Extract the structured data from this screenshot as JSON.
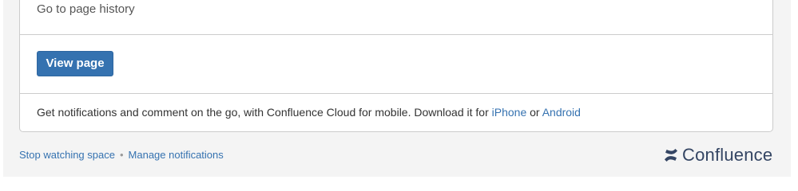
{
  "card": {
    "history_link": "Go to page history",
    "view_button": "View page",
    "mobile": {
      "text_before": "Get notifications and comment on the go, with Confluence Cloud for mobile. Download it for ",
      "iphone_link": "iPhone",
      "or_text": " or ",
      "android_link": "Android"
    }
  },
  "footer": {
    "stop_watching": "Stop watching space",
    "separator": "•",
    "manage_notifications": "Manage notifications"
  },
  "brand": {
    "name": "Confluence",
    "icon": "confluence-logo-icon"
  },
  "colors": {
    "accent": "#3572b0",
    "background": "#f4f4f4",
    "border": "#cccccc",
    "brand": "#344563"
  }
}
